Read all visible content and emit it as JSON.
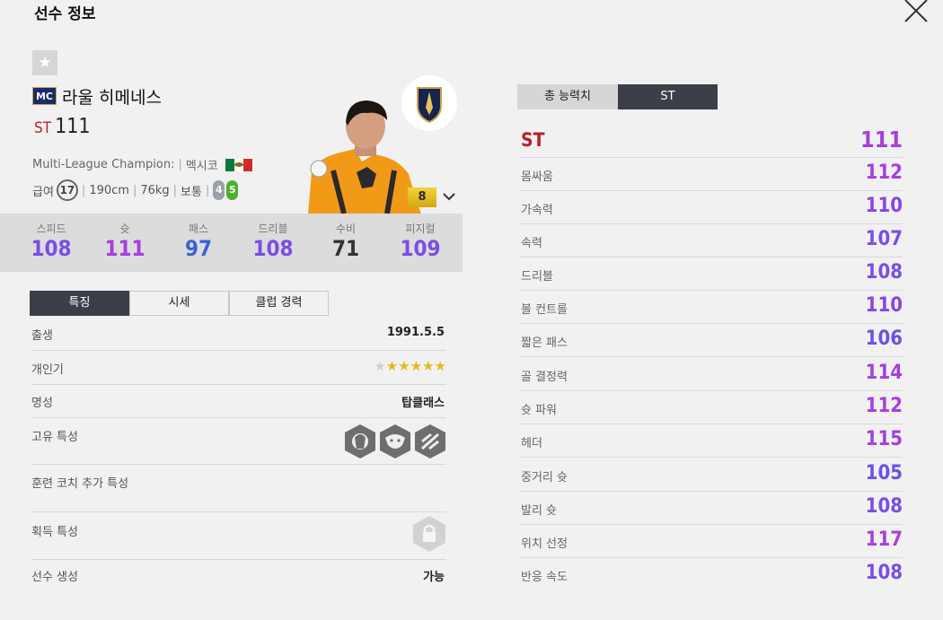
{
  "header": {
    "title": "선수 정보"
  },
  "player": {
    "season_badge": "MC",
    "name": "라울 히메네스",
    "position": "ST",
    "overall": "111",
    "season_name": "Multi-League Champion:",
    "nation": "멕시코",
    "salary_label": "급여",
    "salary": "17",
    "height": "190cm",
    "weight": "76kg",
    "body_type": "보통",
    "weak_foot": "4",
    "strong_foot": "5",
    "enhance_level": "8"
  },
  "stats": [
    {
      "label": "스피드",
      "value": "108",
      "color": "#7a4de8"
    },
    {
      "label": "슛",
      "value": "111",
      "color": "#a63ee0"
    },
    {
      "label": "패스",
      "value": "97",
      "color": "#3a63d8"
    },
    {
      "label": "드리블",
      "value": "108",
      "color": "#7a4de8"
    },
    {
      "label": "수비",
      "value": "71",
      "color": "#333333"
    },
    {
      "label": "피지컬",
      "value": "109",
      "color": "#7a4de8"
    }
  ],
  "tabs": [
    "특징",
    "시세",
    "클럽 경력"
  ],
  "details": {
    "birth_label": "출생",
    "birth": "1991.5.5",
    "skill_label": "개인기",
    "skill_stars": 5,
    "rep_label": "명성",
    "rep": "탑클래스",
    "traits_label": "고유 특성",
    "coach_label": "훈련 코치 추가 특성",
    "acquired_label": "획득 특성",
    "create_label": "선수 생성",
    "create": "가능"
  },
  "right_tabs": [
    "총 능력치",
    "ST"
  ],
  "attributes": {
    "headline": {
      "label": "ST",
      "value": "111"
    },
    "items": [
      {
        "label": "몸싸움",
        "value": "112",
        "color": "#a63ee0"
      },
      {
        "label": "가속력",
        "value": "110",
        "color": "#8a45e3"
      },
      {
        "label": "속력",
        "value": "107",
        "color": "#7a4de8"
      },
      {
        "label": "드리블",
        "value": "108",
        "color": "#7a4de8"
      },
      {
        "label": "볼 컨트롤",
        "value": "110",
        "color": "#8a45e3"
      },
      {
        "label": "짧은 패스",
        "value": "106",
        "color": "#6a52e6"
      },
      {
        "label": "골 결정력",
        "value": "114",
        "color": "#a63ee0"
      },
      {
        "label": "슛 파워",
        "value": "112",
        "color": "#a63ee0"
      },
      {
        "label": "헤더",
        "value": "115",
        "color": "#a63ee0"
      },
      {
        "label": "중거리 슛",
        "value": "105",
        "color": "#6a52e6"
      },
      {
        "label": "발리 슛",
        "value": "108",
        "color": "#7a4de8"
      },
      {
        "label": "위치 선정",
        "value": "117",
        "color": "#a63ee0"
      },
      {
        "label": "반응 속도",
        "value": "108",
        "color": "#7a4de8"
      }
    ]
  }
}
